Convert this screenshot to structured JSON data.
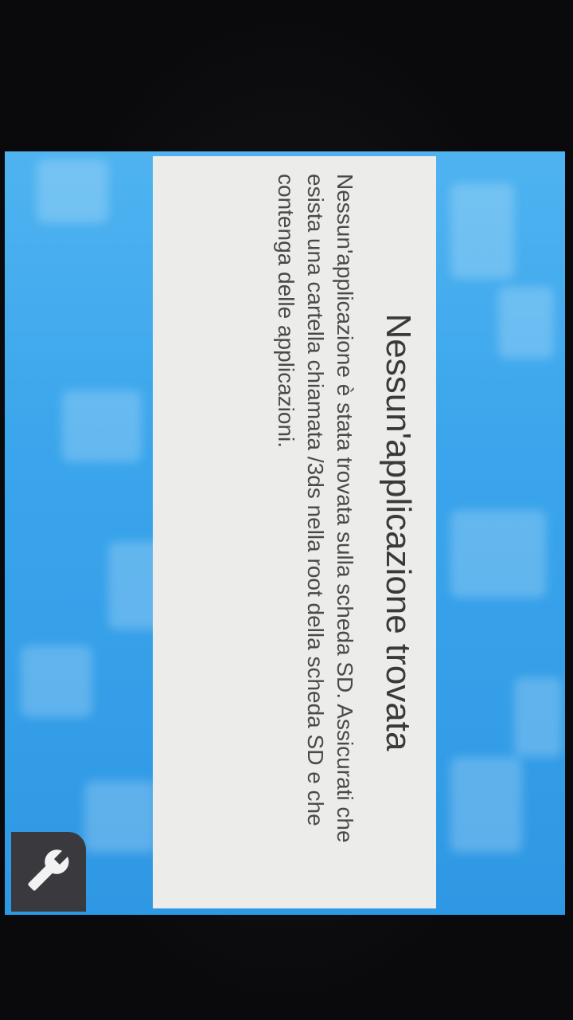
{
  "dialog": {
    "title": "Nessun'applicazione trovata",
    "message": "Nessun'applicazione è stata trovata sulla scheda SD. Assicurati che esista una cartella chiamata /3ds nella root della scheda SD e che contenga delle applicazioni."
  },
  "settings_button": {
    "icon": "wrench-icon"
  },
  "colors": {
    "background_blue": "#3aa5ec",
    "dialog_background": "#ececea",
    "text": "#3b3b3b",
    "button_background": "#3a3a3e"
  }
}
